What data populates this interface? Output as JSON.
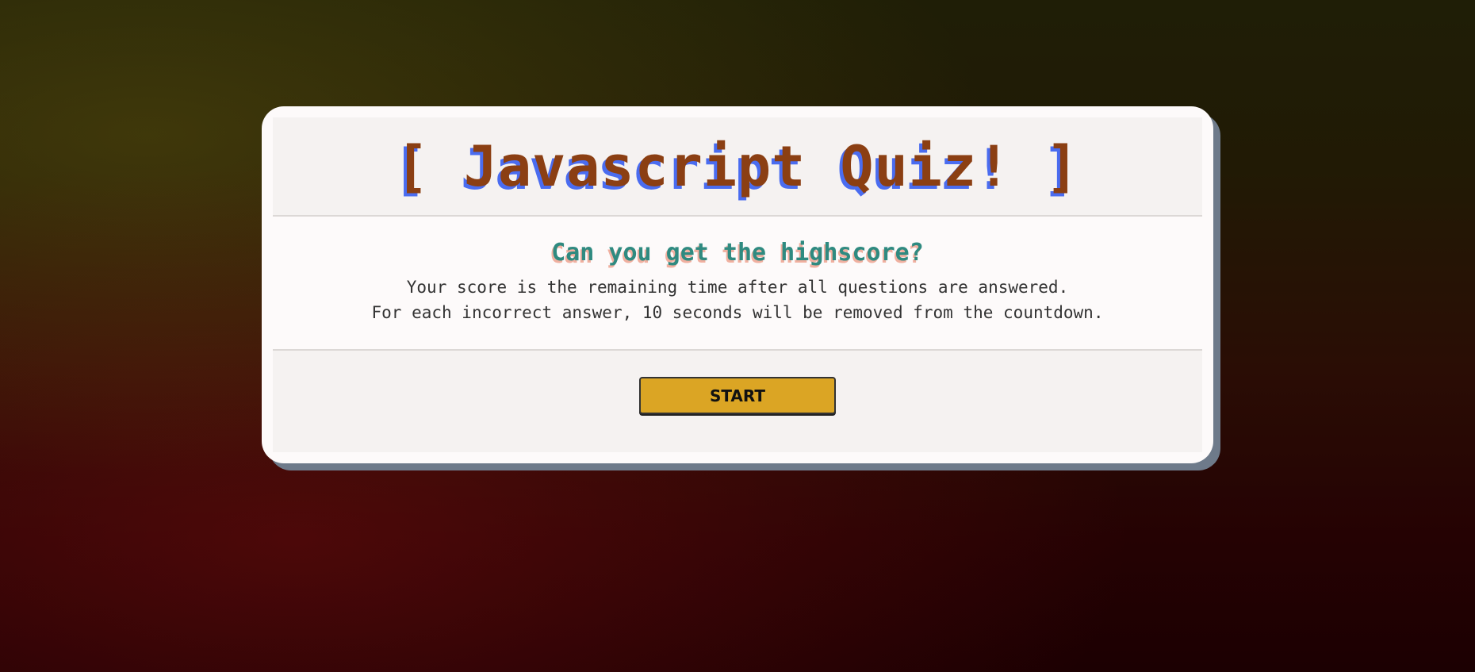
{
  "quiz": {
    "title": "[ Javascript Quiz! ]",
    "subtitle": "Can you get the highscore?",
    "rules": [
      "Your score is the remaining time after all questions are answered.",
      "For each incorrect answer, 10 seconds will be removed from the countdown."
    ],
    "start_label": "START"
  },
  "colors": {
    "title": "#8b3f13",
    "title_shadow": "#4a6cf0",
    "subtitle": "#2f8a80",
    "button": "#dba524"
  }
}
